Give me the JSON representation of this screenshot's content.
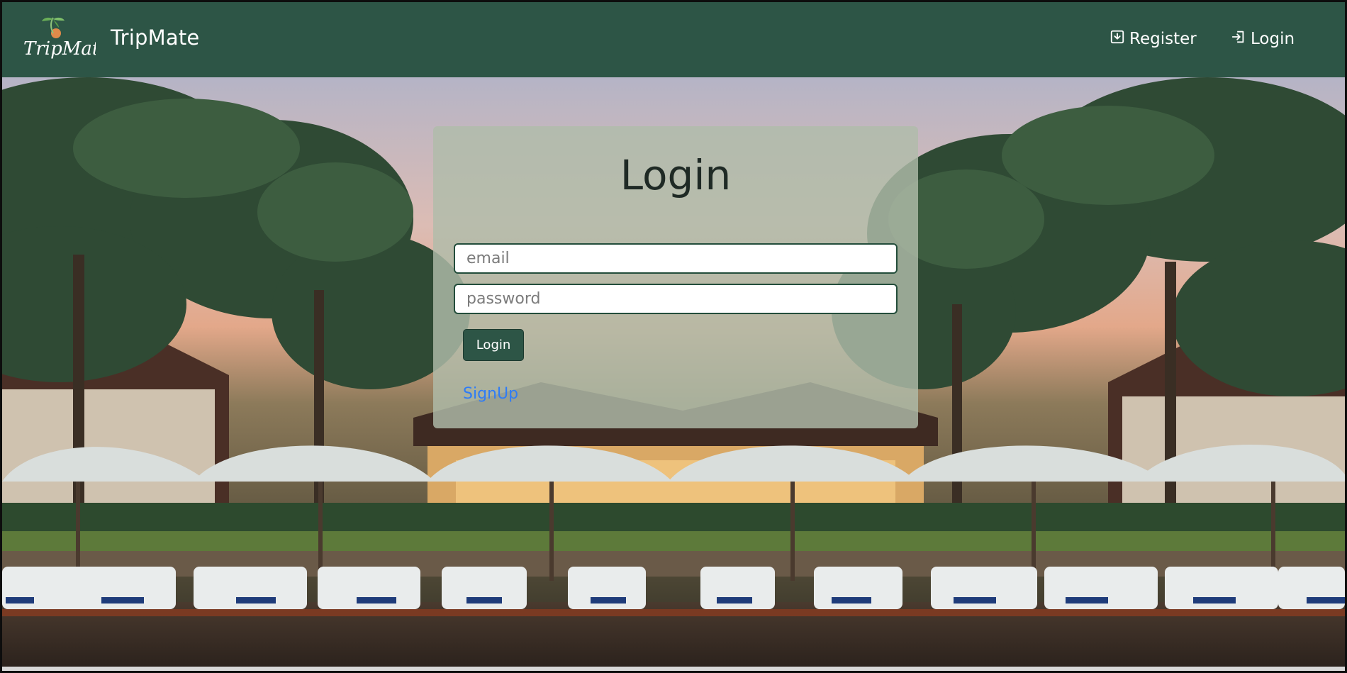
{
  "navbar": {
    "brand_logo_text": "TripMate",
    "brand_name": "TripMate",
    "register_label": "Register",
    "login_label": "Login",
    "register_icon": "download-box-icon",
    "login_icon": "sign-in-icon",
    "background_color": "#2d5546"
  },
  "login_card": {
    "title": "Login",
    "email_placeholder": "email",
    "password_placeholder": "password",
    "submit_label": "Login",
    "signup_link": "SignUp"
  },
  "colors": {
    "accent": "#2d5546",
    "link": "#2f7cf6"
  }
}
